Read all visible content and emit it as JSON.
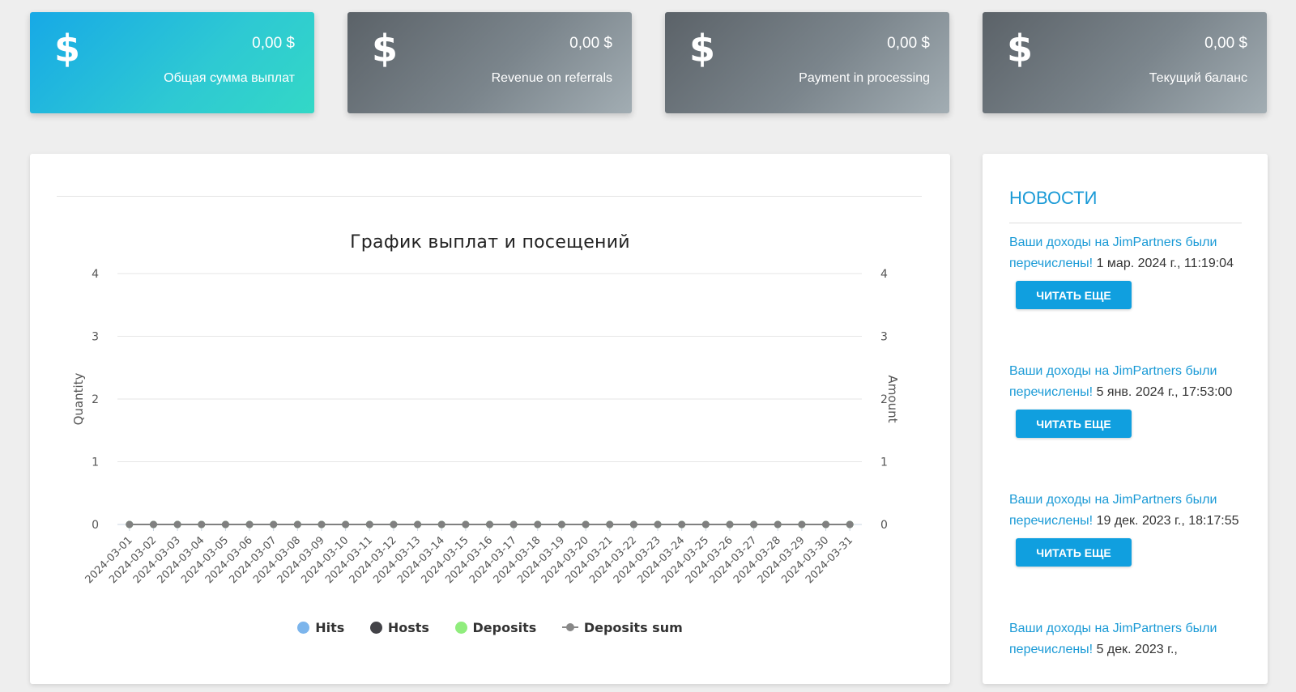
{
  "stats": [
    {
      "amount": "0,00 $",
      "label": "Общая сумма выплат",
      "icon": "dollar-icon"
    },
    {
      "amount": "0,00 $",
      "label": "Revenue on referrals",
      "icon": "dollar-icon"
    },
    {
      "amount": "0,00 $",
      "label": "Payment in processing",
      "icon": "dollar-icon"
    },
    {
      "amount": "0,00 $",
      "label": "Текущий баланс",
      "icon": "dollar-icon"
    }
  ],
  "dollar_symbol": "$",
  "colors": {
    "accent": "#1a9ad6",
    "button": "#109fdf",
    "card_blue": "#17a9e6",
    "card_gray": "#6b747a"
  },
  "chart_data": {
    "type": "line",
    "title": "График выплат и посещений",
    "ylabel": "Quantity",
    "ylabel_right": "Amount",
    "ylim": [
      0,
      4
    ],
    "yticks": [
      "0",
      "1",
      "2",
      "3",
      "4"
    ],
    "grid": true,
    "legend_position": "bottom",
    "categories": [
      "2024-03-01",
      "2024-03-02",
      "2024-03-03",
      "2024-03-04",
      "2024-03-05",
      "2024-03-06",
      "2024-03-07",
      "2024-03-08",
      "2024-03-09",
      "2024-03-10",
      "2024-03-11",
      "2024-03-12",
      "2024-03-13",
      "2024-03-14",
      "2024-03-15",
      "2024-03-16",
      "2024-03-17",
      "2024-03-18",
      "2024-03-19",
      "2024-03-20",
      "2024-03-21",
      "2024-03-22",
      "2024-03-23",
      "2024-03-24",
      "2024-03-25",
      "2024-03-26",
      "2024-03-27",
      "2024-03-28",
      "2024-03-29",
      "2024-03-30",
      "2024-03-31"
    ],
    "series": [
      {
        "name": "Hits",
        "color": "#7cb5ec",
        "values": [
          0,
          0,
          0,
          0,
          0,
          0,
          0,
          0,
          0,
          0,
          0,
          0,
          0,
          0,
          0,
          0,
          0,
          0,
          0,
          0,
          0,
          0,
          0,
          0,
          0,
          0,
          0,
          0,
          0,
          0,
          0
        ]
      },
      {
        "name": "Hosts",
        "color": "#434348",
        "values": [
          0,
          0,
          0,
          0,
          0,
          0,
          0,
          0,
          0,
          0,
          0,
          0,
          0,
          0,
          0,
          0,
          0,
          0,
          0,
          0,
          0,
          0,
          0,
          0,
          0,
          0,
          0,
          0,
          0,
          0,
          0
        ]
      },
      {
        "name": "Deposits",
        "color": "#90ed7d",
        "values": [
          0,
          0,
          0,
          0,
          0,
          0,
          0,
          0,
          0,
          0,
          0,
          0,
          0,
          0,
          0,
          0,
          0,
          0,
          0,
          0,
          0,
          0,
          0,
          0,
          0,
          0,
          0,
          0,
          0,
          0,
          0
        ]
      },
      {
        "name": "Deposits sum",
        "color": "#808080",
        "values": [
          0,
          0,
          0,
          0,
          0,
          0,
          0,
          0,
          0,
          0,
          0,
          0,
          0,
          0,
          0,
          0,
          0,
          0,
          0,
          0,
          0,
          0,
          0,
          0,
          0,
          0,
          0,
          0,
          0,
          0,
          0
        ]
      }
    ]
  },
  "news": {
    "title": "НОВОСТИ",
    "read_more": "ЧИТАТЬ ЕЩЕ",
    "items": [
      {
        "link": "Ваши доходы на JimPartners были перечислены!",
        "date": "1 мар. 2024 г., 11:19:04"
      },
      {
        "link": "Ваши доходы на JimPartners были перечислены!",
        "date": "5 янв. 2024 г., 17:53:00"
      },
      {
        "link": "Ваши доходы на JimPartners были перечислены!",
        "date": "19 дек. 2023 г., 18:17:55"
      },
      {
        "link": "Ваши доходы на JimPartners были перечислены!",
        "date": "5 дек. 2023 г.,"
      }
    ]
  }
}
